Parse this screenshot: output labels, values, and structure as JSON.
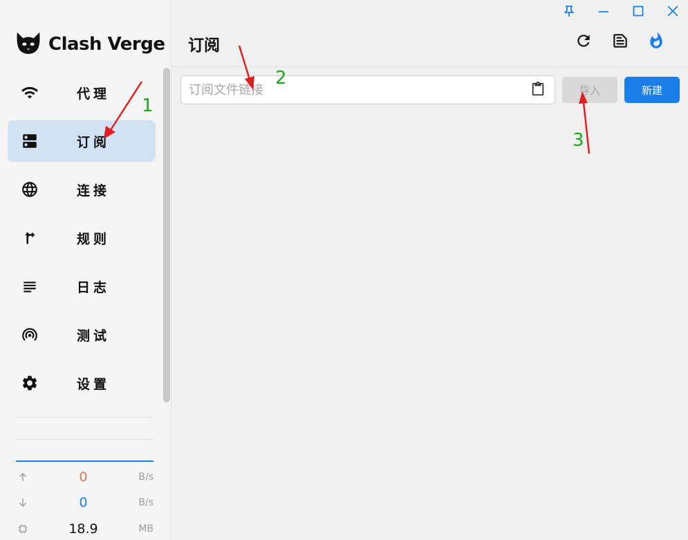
{
  "window": {
    "controls": [
      {
        "name": "pin-icon"
      },
      {
        "name": "minimize-icon"
      },
      {
        "name": "maximize-icon"
      },
      {
        "name": "close-icon"
      }
    ],
    "accent_color": "#1a7ee8"
  },
  "app": {
    "name": "Clash Verge",
    "logo_icon": "cat-icon"
  },
  "sidebar": {
    "items": [
      {
        "label": "代理",
        "icon": "wifi-icon",
        "active": false
      },
      {
        "label": "订阅",
        "icon": "dns-icon",
        "active": true
      },
      {
        "label": "连接",
        "icon": "globe-icon",
        "active": false
      },
      {
        "label": "规则",
        "icon": "fork-arrow-icon",
        "active": false
      },
      {
        "label": "日志",
        "icon": "notes-icon",
        "active": false
      },
      {
        "label": "测试",
        "icon": "radar-icon",
        "active": false
      },
      {
        "label": "设置",
        "icon": "gear-icon",
        "active": false
      }
    ],
    "traffic": {
      "upload": {
        "value": "0",
        "unit": "B/s",
        "color": "#e8775a"
      },
      "download": {
        "value": "0",
        "unit": "B/s",
        "color": "#1a7ee8"
      },
      "memory": {
        "value": "18.9",
        "unit": "MB"
      }
    }
  },
  "main": {
    "title": "订阅",
    "header_actions": [
      "refresh-icon",
      "text-snippet-icon",
      "fire-icon"
    ],
    "url_input": {
      "placeholder": "订阅文件链接",
      "value": ""
    },
    "import_label": "导入",
    "new_label": "新建"
  },
  "annotations": {
    "numbers": [
      "1",
      "2",
      "3"
    ],
    "color": "#1ca81c",
    "arrow_color": "#e02020"
  }
}
